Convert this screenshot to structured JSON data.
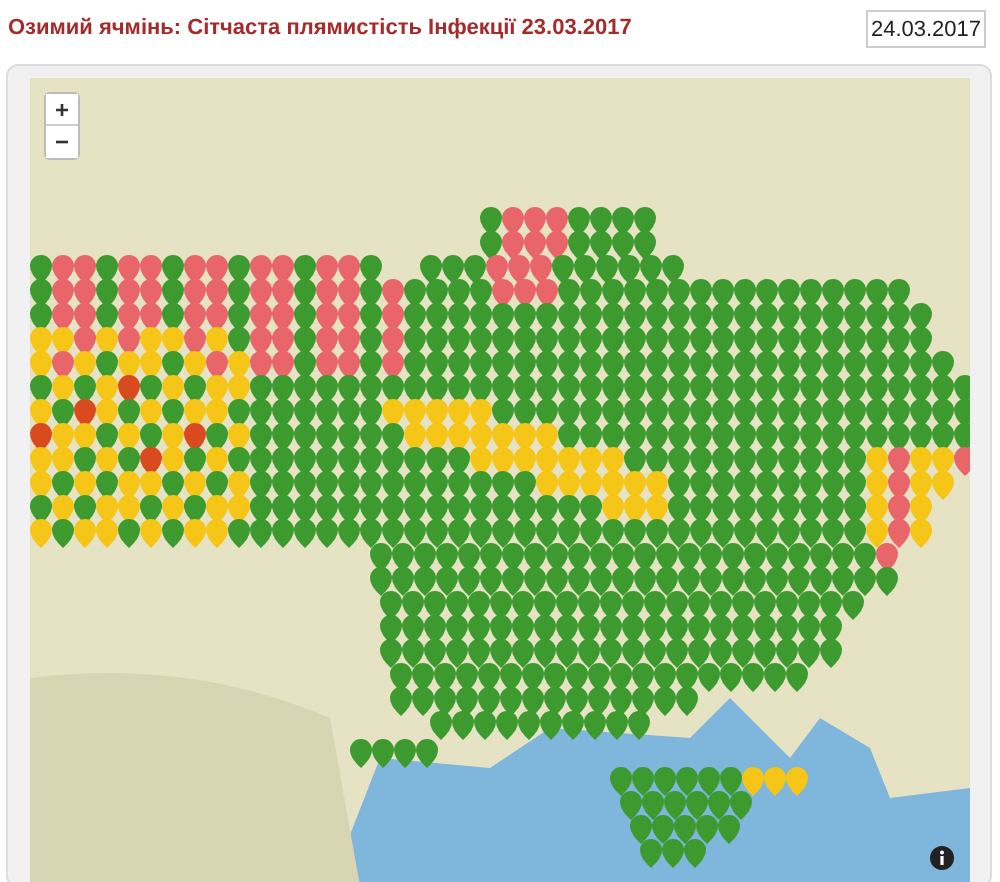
{
  "title": "Озимий ячмінь: Сітчаста плямистість Інфекції 23.03.2017",
  "date_field": {
    "value": "24.03.2017"
  },
  "map": {
    "zoom_in": "+",
    "zoom_out": "−"
  }
}
